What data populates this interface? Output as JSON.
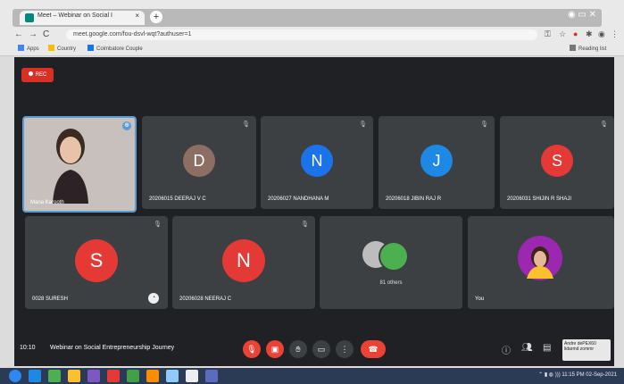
{
  "browser": {
    "tab_title": "Meet – Webinar on Social I",
    "tab_close": "×",
    "new_tab": "+",
    "url": "meet.google.com/fou-dsvl-wqt?authuser=1",
    "nav": {
      "back": "←",
      "forward": "→",
      "reload": "C"
    },
    "bookmarks": [
      {
        "label": "Apps",
        "color": "#4285f4"
      },
      {
        "label": "Country",
        "color": "#fbbc05"
      },
      {
        "label": "Coimbatore Couple",
        "color": "#1a73e8"
      }
    ],
    "reading_list": "Reading list"
  },
  "meet": {
    "rec_label": "REC",
    "participants": [
      {
        "name": "Maria Karooth",
        "type": "video"
      },
      {
        "name": "20206015 DEERAJ V C",
        "initial": "D",
        "color": "#8d6e63"
      },
      {
        "name": "20206027 NANDHANA M",
        "initial": "N",
        "color": "#1a73e8"
      },
      {
        "name": "20206018 JIBIN RAJ R",
        "initial": "J",
        "color": "#1e88e5"
      },
      {
        "name": "20206031 SHIJIN R SHAJI",
        "initial": "S",
        "color": "#e53935"
      },
      {
        "name": "0028 SURESH",
        "initial": "S",
        "color": "#e53935"
      },
      {
        "name": "20206028 NEERAJ C",
        "initial": "N",
        "color": "#e53935"
      },
      {
        "name": "81 others",
        "type": "group"
      },
      {
        "name": "You",
        "type": "self"
      }
    ],
    "time": "10:10",
    "meeting_title": "Webinar on Social Entrepreneurship Journey",
    "tooltip": "Andre dePEX60 lidarmd zommr"
  },
  "taskbar": {
    "tray_time": "11:15 PM",
    "tray_date": "02-Sep-2021"
  }
}
